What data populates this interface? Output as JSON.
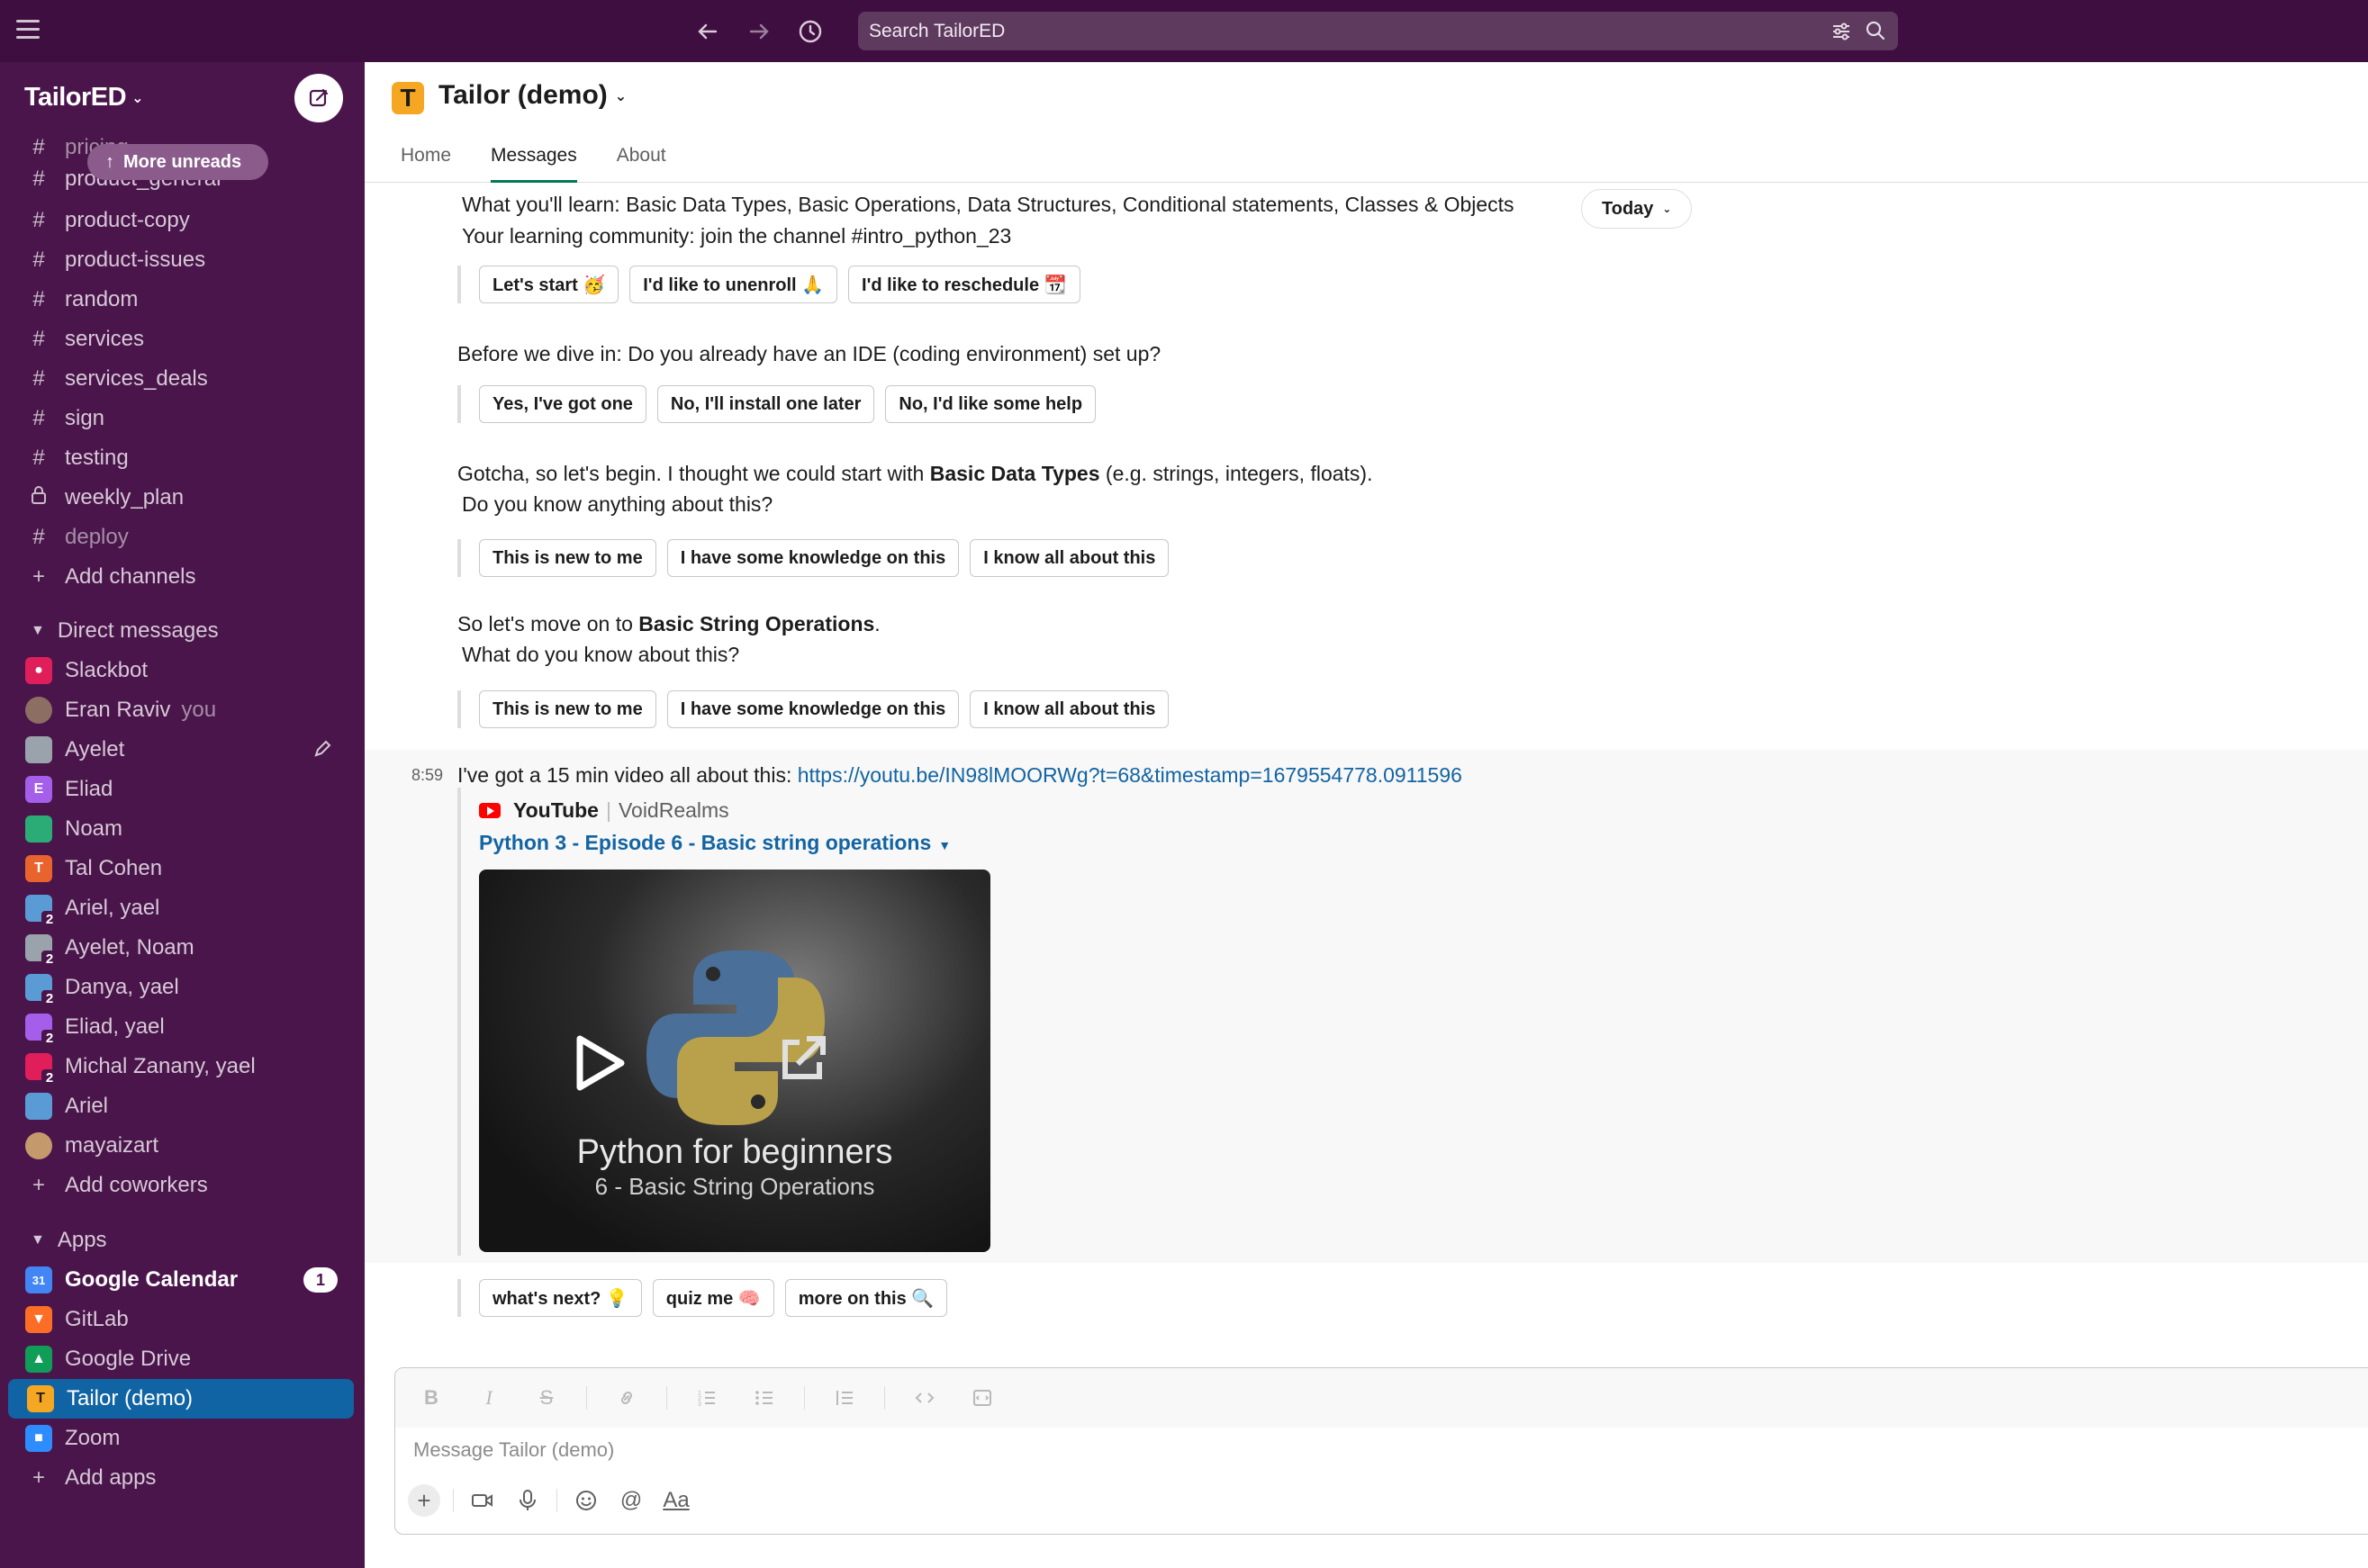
{
  "search": {
    "placeholder": "Search TailorED"
  },
  "workspace": {
    "name": "TailorED"
  },
  "more_unreads": "More unreads",
  "channels": [
    {
      "name": "pricing",
      "glyph": "#"
    },
    {
      "name": "product_general",
      "glyph": "#"
    },
    {
      "name": "product-copy",
      "glyph": "#"
    },
    {
      "name": "product-issues",
      "glyph": "#"
    },
    {
      "name": "random",
      "glyph": "#"
    },
    {
      "name": "services",
      "glyph": "#"
    },
    {
      "name": "services_deals",
      "glyph": "#"
    },
    {
      "name": "sign",
      "glyph": "#"
    },
    {
      "name": "testing",
      "glyph": "#"
    },
    {
      "name": "weekly_plan",
      "glyph": "lock"
    },
    {
      "name": "deploy",
      "glyph": "#"
    }
  ],
  "add_channels": "Add channels",
  "dm_section": "Direct messages",
  "dms": [
    {
      "name": "Slackbot",
      "color": "#e01e5a"
    },
    {
      "name": "Eran Raviv",
      "suffix": "you",
      "color": "#8d6e63"
    },
    {
      "name": "Ayelet",
      "color": "#9aa3ab"
    },
    {
      "name": "Eliad",
      "letter": "E",
      "color": "#a55eea"
    },
    {
      "name": "Noam",
      "color": "#2bac76"
    },
    {
      "name": "Tal Cohen",
      "letter": "T",
      "color": "#e8642c"
    },
    {
      "name": "Ariel, yael",
      "count": "2",
      "color": "#5b9bd5"
    },
    {
      "name": "Ayelet, Noam",
      "count": "2",
      "color": "#9aa3ab"
    },
    {
      "name": "Danya, yael",
      "count": "2",
      "color": "#5b9bd5"
    },
    {
      "name": "Eliad, yael",
      "count": "2",
      "color": "#a55eea"
    },
    {
      "name": "Michal Zanany, yael",
      "count": "2",
      "color": "#e01e5a"
    },
    {
      "name": "Ariel",
      "color": "#5b9bd5"
    },
    {
      "name": "mayaizart",
      "color": "#c49a6c"
    }
  ],
  "add_coworkers": "Add coworkers",
  "apps_section": "Apps",
  "apps": [
    {
      "name": "Google Calendar",
      "badge": "1",
      "color": "#4285f4",
      "letter": "31"
    },
    {
      "name": "GitLab",
      "color": "#fc6d26"
    },
    {
      "name": "Google Drive",
      "color": "#0f9d58"
    },
    {
      "name": "Tailor (demo)",
      "color": "#f5a623",
      "letter": "T"
    },
    {
      "name": "Zoom",
      "color": "#2d8cff"
    }
  ],
  "add_apps": "Add apps",
  "channel": {
    "title": "Tailor (demo)",
    "icon_letter": "T"
  },
  "tabs": [
    "Home",
    "Messages",
    "About"
  ],
  "date_divider": "Today",
  "messages": {
    "learn": "What you'll learn: Basic Data Types, Basic Operations, Data Structures, Conditional statements, Classes & Objects",
    "community": "Your learning community: join the channel #intro_python_23",
    "row1": [
      "Let's start 🥳",
      "I'd like to unenroll 🙏",
      "I'd like to reschedule 📆"
    ],
    "ide_q": "Before we dive in: Do you already have an IDE (coding environment) set up?",
    "row2": [
      "Yes, I've got one",
      "No, I'll install one later",
      "No, I'd like some help"
    ],
    "gotcha_a": "Gotcha, so let's begin. I thought we could start with ",
    "gotcha_b": "Basic Data Types",
    "gotcha_c": " (e.g. strings, integers, floats).",
    "know_q": "Do you know anything about this?",
    "row3": [
      "This is new to me",
      "I have some knowledge on this",
      "I know all about this"
    ],
    "move_a": "So let's move on to ",
    "move_b": "Basic String Operations",
    "move_c": ".",
    "know_q2": "What do you know about this?",
    "row4": [
      "This is new to me",
      "I have some knowledge on this",
      "I know all about this"
    ],
    "time": "8:59",
    "video_text": "I've got a 15 min video all about this: ",
    "video_url": "https://youtu.be/IN98lMOORWg?t=68&timestamp=1679554778.0911596",
    "yt_source": "YouTube",
    "yt_channel": "VoidRealms",
    "video_title": "Python 3 - Episode 6 - Basic string operations",
    "thumb_title": "Python for beginners",
    "thumb_subtitle": "6 - Basic String Operations",
    "row5": [
      "what's next? 💡",
      "quiz me 🧠",
      "more on this 🔍"
    ]
  },
  "composer": {
    "placeholder": "Message Tailor (demo)",
    "aa": "Aa"
  }
}
